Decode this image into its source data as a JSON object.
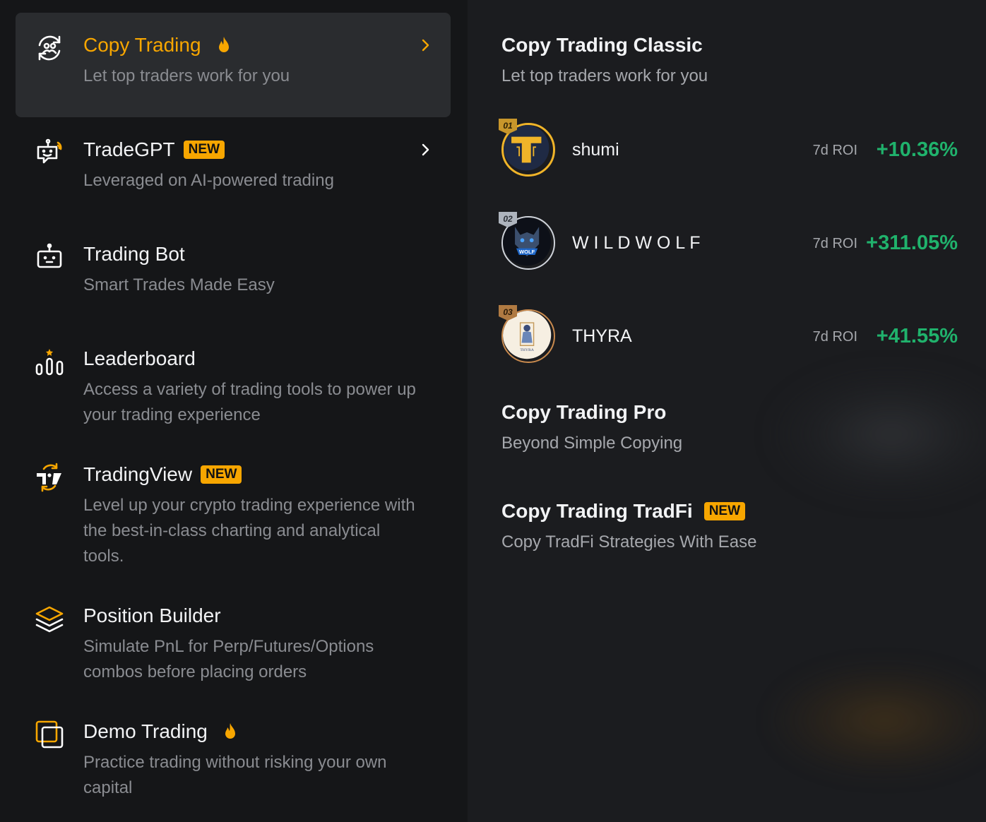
{
  "menu": {
    "items": [
      {
        "title": "Copy Trading",
        "desc": "Let top traders work for you",
        "icon": "copy-trading-icon",
        "hot": true,
        "badge": "",
        "active": true
      },
      {
        "title": "TradeGPT",
        "desc": "Leveraged on AI-powered trading",
        "icon": "tradegpt-icon",
        "hot": false,
        "badge": "NEW",
        "active": false
      },
      {
        "title": "Trading Bot",
        "desc": "Smart Trades Made Easy",
        "icon": "trading-bot-icon",
        "hot": false,
        "badge": "",
        "active": false
      },
      {
        "title": "Leaderboard",
        "desc": "Access a variety of trading tools to power up your trading experience",
        "icon": "leaderboard-icon",
        "hot": false,
        "badge": "",
        "active": false
      },
      {
        "title": "TradingView",
        "desc": "Level up your crypto trading experience with the best-in-class charting and analytical tools.",
        "icon": "tradingview-icon",
        "hot": false,
        "badge": "NEW",
        "active": false
      },
      {
        "title": "Position Builder",
        "desc": "Simulate PnL for Perp/Futures/Options combos before placing orders",
        "icon": "layers-icon",
        "hot": false,
        "badge": "",
        "active": false
      },
      {
        "title": "Demo Trading",
        "desc": "Practice trading without risking your own capital",
        "icon": "demo-trading-icon",
        "hot": true,
        "badge": "",
        "active": false
      }
    ]
  },
  "panel": {
    "classic": {
      "title": "Copy Trading Classic",
      "subtitle": "Let top traders work for you"
    },
    "traders": [
      {
        "rank": "01",
        "name": "shumi",
        "roi_label": "7d ROI",
        "roi": "+10.36%"
      },
      {
        "rank": "02",
        "name": "W I L D W O L F",
        "roi_label": "7d ROI",
        "roi": "+311.05%"
      },
      {
        "rank": "03",
        "name": "THYRA",
        "roi_label": "7d ROI",
        "roi": "+41.55%"
      }
    ],
    "pro": {
      "title": "Copy Trading Pro",
      "subtitle": "Beyond Simple Copying"
    },
    "tradfi": {
      "title": "Copy Trading TradFi",
      "badge": "NEW",
      "subtitle": "Copy TradFi Strategies With Ease"
    }
  },
  "colors": {
    "accent": "#f7a600",
    "positive": "#20b26c",
    "bg_left": "#151618",
    "bg_right": "#1b1c1f"
  }
}
